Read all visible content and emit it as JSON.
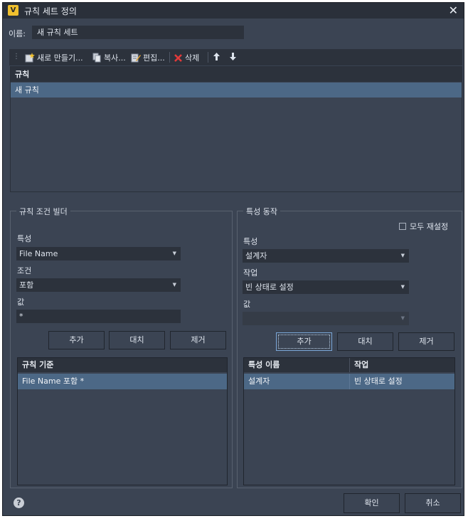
{
  "window": {
    "title": "규칙 세트 정의",
    "app_icon": "V",
    "close": "✕"
  },
  "name_field": {
    "label": "이름:",
    "value": "새 규칙 세트"
  },
  "toolbar": {
    "new_label": "새로 만들기...",
    "copy_label": "복사...",
    "edit_label": "편집...",
    "delete_label": "삭제",
    "up_icon": "🡅",
    "down_icon": "🡇"
  },
  "rules": {
    "header": "규칙",
    "rows": [
      "새 규칙"
    ]
  },
  "condition_builder": {
    "title": "규칙 조건 빌더",
    "property_label": "특성",
    "property_value": "File Name",
    "condition_label": "조건",
    "condition_value": "포함",
    "value_label": "값",
    "value_value": "*",
    "buttons": {
      "add": "추가",
      "replace": "대치",
      "remove": "제거"
    },
    "criteria": {
      "header": "규칙 기준",
      "rows": [
        "File Name 포함 *"
      ]
    }
  },
  "property_action": {
    "title": "특성 동작",
    "reset_all_label": "모두 재설정",
    "property_label": "특성",
    "property_value": "설계자",
    "action_label": "작업",
    "action_value": "빈 상태로 설정",
    "value_label": "값",
    "value_value": "",
    "buttons": {
      "add": "추가",
      "replace": "대치",
      "remove": "제거"
    },
    "table": {
      "columns": [
        "특성 이름",
        "작업"
      ],
      "rows": [
        [
          "설계자",
          "빈 상태로 설정"
        ]
      ]
    }
  },
  "footer": {
    "help": "?",
    "ok": "확인",
    "cancel": "취소"
  },
  "colors": {
    "background": "#3b4453",
    "selection": "#4c6886",
    "field": "#2c323c",
    "title_bar": "#2a303a"
  }
}
